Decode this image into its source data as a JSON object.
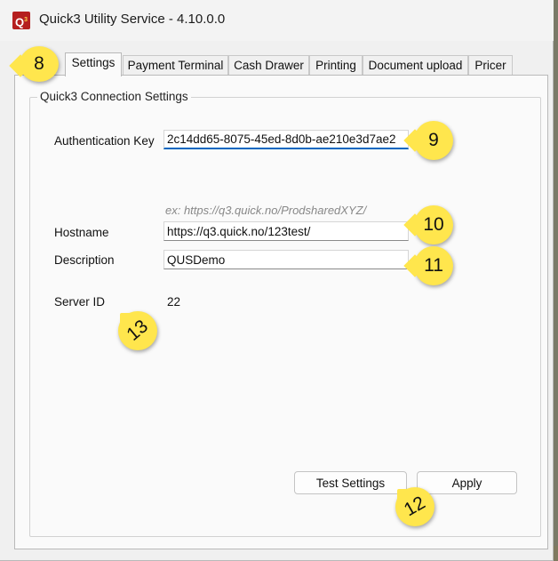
{
  "window": {
    "title": "Quick3 Utility Service - 4.10.0.0",
    "icon_name": "q3-app-icon",
    "icon_text": "Q"
  },
  "tabs": [
    {
      "label": "Settings",
      "active": true
    },
    {
      "label": "Payment Terminal",
      "active": false
    },
    {
      "label": "Cash Drawer",
      "active": false
    },
    {
      "label": "Printing",
      "active": false
    },
    {
      "label": "Document upload",
      "active": false
    },
    {
      "label": "Pricer",
      "active": false
    }
  ],
  "group": {
    "title": "Quick3 Connection Settings"
  },
  "form": {
    "auth_key_label": "Authentication Key",
    "auth_key_value": "2c14dd65-8075-45ed-8d0b-ae210e3d7ae2",
    "hostname_hint": "ex: https://q3.quick.no/ProdsharedXYZ/",
    "hostname_label": "Hostname",
    "hostname_value": "https://q3.quick.no/123test/",
    "description_label": "Description",
    "description_value": "QUSDemo",
    "server_id_label": "Server ID",
    "server_id_value": "22"
  },
  "buttons": {
    "test_settings": "Test Settings",
    "apply": "Apply"
  },
  "callouts": {
    "c8": "8",
    "c9": "9",
    "c10": "10",
    "c11": "11",
    "c12": "12",
    "c13": "13"
  },
  "colors": {
    "callout": "#ffe64d",
    "focus_accent": "#0067c0"
  }
}
